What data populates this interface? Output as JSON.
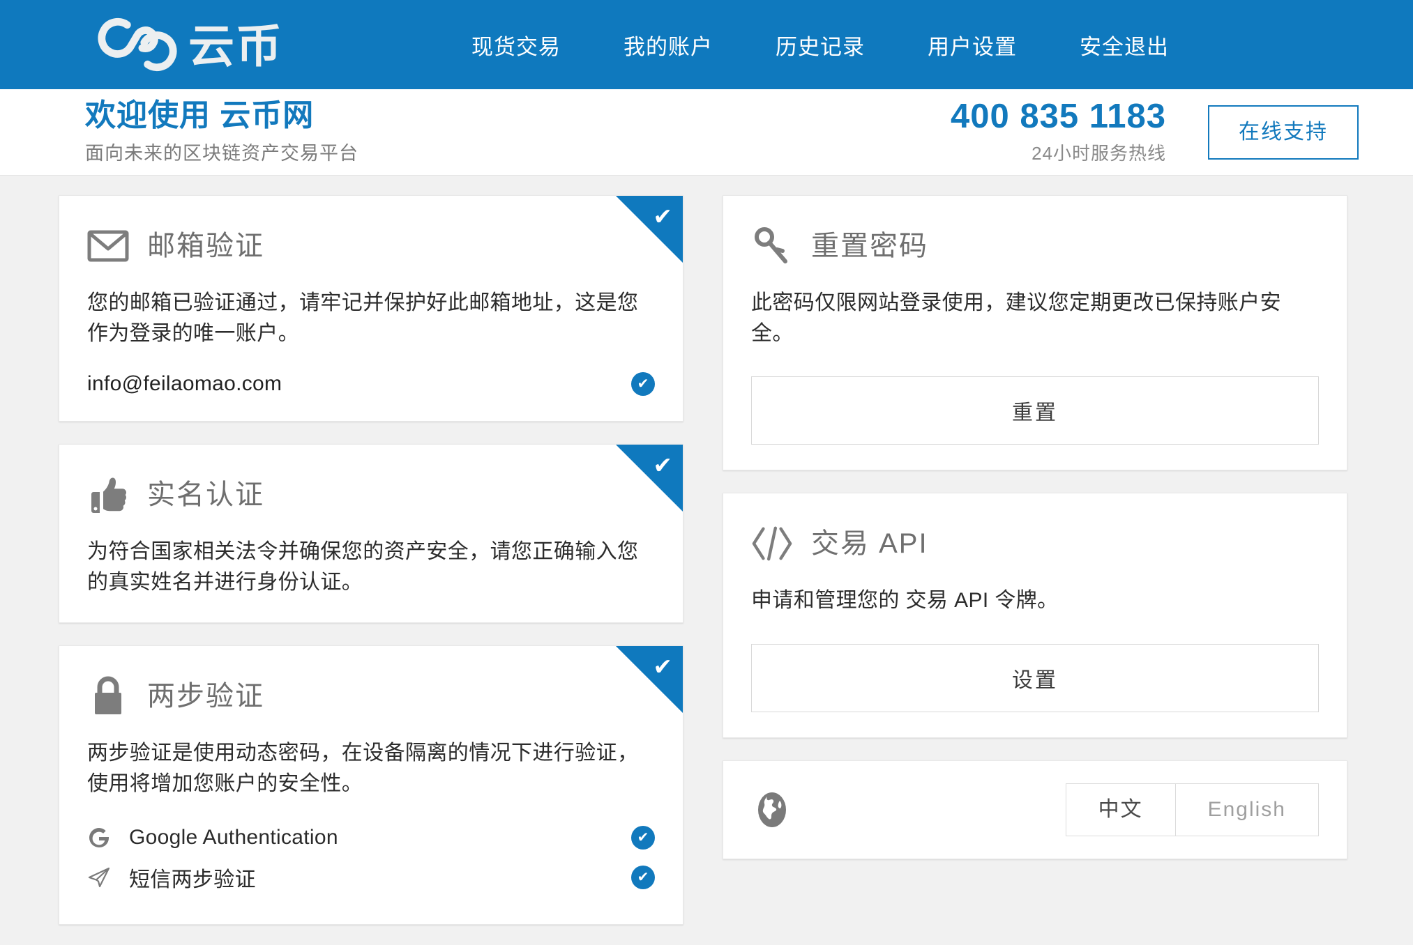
{
  "header": {
    "brand_text": "云币",
    "brand_logo_icon": "yunbi-chain-logo-icon",
    "nav": [
      {
        "label": "现货交易",
        "name": "nav-spot-trading"
      },
      {
        "label": "我的账户",
        "name": "nav-my-account"
      },
      {
        "label": "历史记录",
        "name": "nav-history"
      },
      {
        "label": "用户设置",
        "name": "nav-user-settings"
      },
      {
        "label": "安全退出",
        "name": "nav-logout"
      }
    ]
  },
  "welcome": {
    "title": "欢迎使用 云币网",
    "subtitle": "面向未来的区块链资产交易平台",
    "phone": "400 835 1183",
    "phone_caption": "24小时服务热线",
    "support_button": "在线支持"
  },
  "cards": {
    "email": {
      "icon": "envelope-icon",
      "title": "邮箱验证",
      "body": "您的邮箱已验证通过，请牢记并保护好此邮箱地址，这是您作为登录的唯一账户。",
      "value": "info@feilaomao.com",
      "verified_badge": "✔",
      "ribbon_tick": "✔"
    },
    "identity": {
      "icon": "thumbs-up-icon",
      "title": "实名认证",
      "body": "为符合国家相关法令并确保您的资产安全，请您正确输入您的真实姓名并进行身份认证。",
      "ribbon_tick": "✔"
    },
    "twofa": {
      "icon": "lock-icon",
      "title": "两步验证",
      "body": "两步验证是使用动态密码，在设备隔离的情况下进行验证，使用将增加您账户的安全性。",
      "ribbon_tick": "✔",
      "items": [
        {
          "icon": "google-g-icon",
          "label": "Google Authentication",
          "badge": "✔"
        },
        {
          "icon": "paper-plane-icon",
          "label": "短信两步验证",
          "badge": "✔"
        }
      ]
    },
    "password": {
      "icon": "key-icon",
      "title": "重置密码",
      "body": "此密码仅限网站登录使用，建议您定期更改已保持账户安全。",
      "action": "重置"
    },
    "api": {
      "icon": "code-brackets-icon",
      "title": "交易 API",
      "body": "申请和管理您的 交易 API 令牌。",
      "action": "设置"
    },
    "language": {
      "icon": "globe-icon",
      "options": [
        {
          "label": "中文",
          "active": true
        },
        {
          "label": "English",
          "active": false
        }
      ]
    }
  },
  "colors": {
    "brand_blue": "#0f79be",
    "link_blue": "#1279bd",
    "page_bg": "#f1f1f1",
    "card_bg": "#ffffff",
    "icon_gray": "#7d7d7d"
  }
}
